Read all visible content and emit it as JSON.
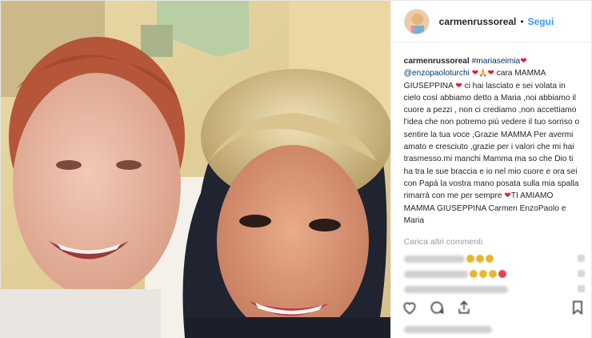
{
  "post": {
    "username": "carmenrussoreal",
    "separator": "•",
    "follow_label": "Segui",
    "caption": {
      "username": "carmenrussoreal",
      "hashtag": "#mariaseimia",
      "mention": "@enzopaoloturchi",
      "text_1": "cara MAMMA GIUSEPPINA",
      "text_2": "ci hai lasciato e sei volata in cielo così abbiamo detto a Maria ,noi abbiamo il cuore a pezzi , non ci crediamo ,non accettiamo l'idea che non potremo più vedere il tuo sorriso o sentire la tua voce ,Grazie MAMMA Per avermi amato e cresciuto ,grazie per i valori che mi hai trasmesso.mi manchi Mamma ma so che Dio ti ha tra le sue braccia e io nel mio cuore e ora sei con Papà la vostra mano posata sulla mia spalla rimarrà con me per sempre",
      "text_3": "TI AMIAMO MAMMA GIUSEPPINA Carmen EnzoPaolo e Maria"
    },
    "load_more_comments": "Carica altri commenti"
  },
  "colors": {
    "link_blue": "#3897f0",
    "hashtag_blue": "#003569",
    "heart_red": "#ed1c2e",
    "muted_gray": "#999999"
  },
  "icons": {
    "like": "heart-outline-icon",
    "comment": "speech-bubble-icon",
    "share": "share-icon",
    "save": "bookmark-icon",
    "caption_hearts": "red-heart-emoji",
    "caption_prayer": "praying-hands-emoji"
  }
}
